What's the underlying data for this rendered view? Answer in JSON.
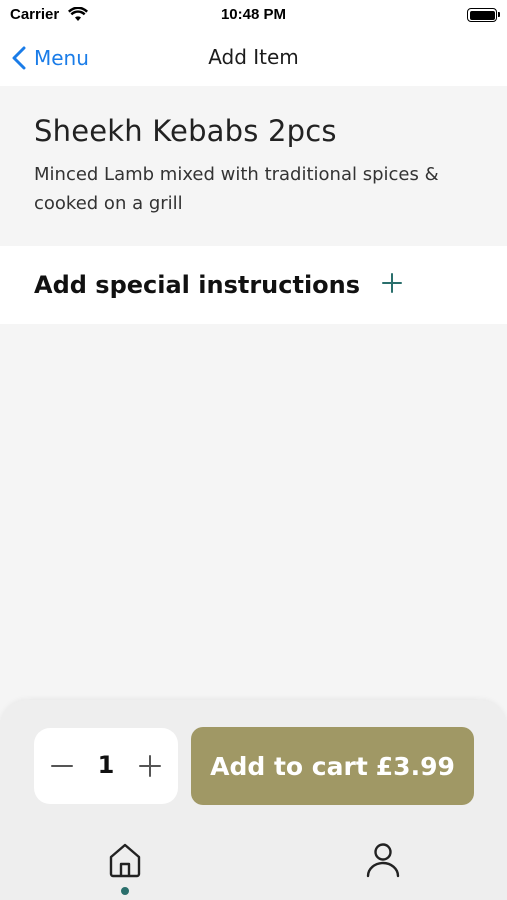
{
  "status_bar": {
    "carrier": "Carrier",
    "time": "10:48 PM",
    "wifi_icon": "wifi-icon",
    "battery_icon": "battery-icon"
  },
  "nav": {
    "back_label": "Menu",
    "back_icon": "chevron-left-icon",
    "title": "Add Item"
  },
  "item": {
    "name": "Sheekh Kebabs 2pcs",
    "description": "Minced Lamb mixed with traditional spices & cooked on a grill"
  },
  "special_instructions": {
    "label": "Add special instructions",
    "icon": "plus-icon"
  },
  "order": {
    "quantity": "1",
    "minus_icon": "minus-icon",
    "plus_icon": "plus-icon",
    "add_to_cart_label": "Add to cart",
    "price": "£3.99"
  },
  "tab_bar": {
    "tabs": [
      {
        "icon": "home-icon",
        "active": true
      },
      {
        "icon": "profile-icon",
        "active": false
      }
    ]
  },
  "colors": {
    "accent_blue": "#1a7ce8",
    "teal": "#2a6f6c",
    "cart_button": "#a09865",
    "background": "#f5f5f5"
  }
}
